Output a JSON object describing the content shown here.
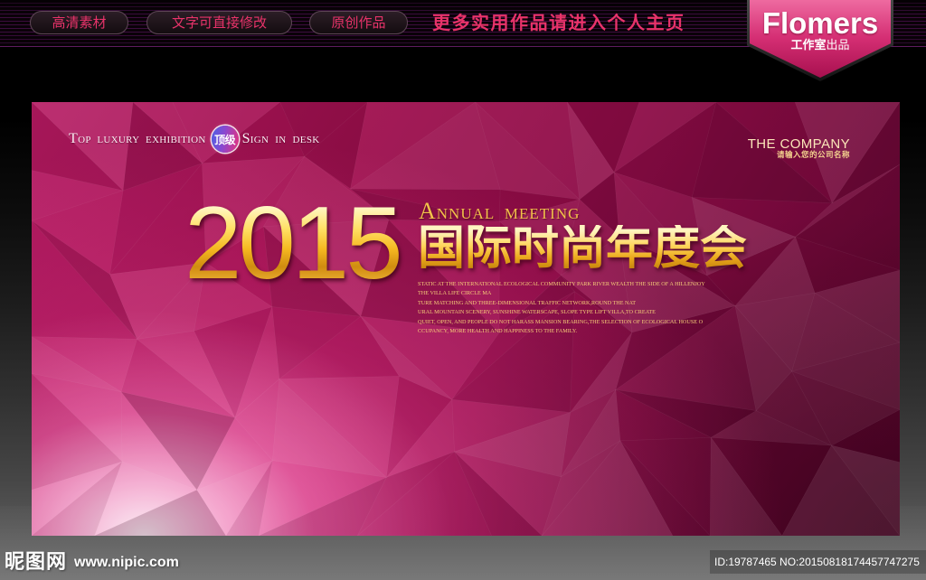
{
  "top_bar": {
    "tags": [
      {
        "label": "高清素材"
      },
      {
        "label": "文字可直接修改"
      },
      {
        "label": "原创作品"
      }
    ],
    "promo": "更多实用作品请进入个人主页"
  },
  "badge": {
    "brand": "Flomers",
    "studio": "工作室",
    "produced": "出品"
  },
  "banner": {
    "tagline": {
      "left": "TOP LUXURY EXHIBITION",
      "seal": "顶级",
      "right": "SIGN IN DESK"
    },
    "company": {
      "name": "THE COMPANY",
      "hint": "请输入您的公司名称"
    },
    "year": "2015",
    "subtitle_en": "ANNUAL MEETING",
    "title_cn": "国际时尚年度会",
    "description_lines": [
      "STATIC AT THE INTERNATIONAL ECOLOGICAL COMMUNITY PARK RIVER WEALTH THE SIDE OF A HILLENJOY",
      "THE VILLA LIFE CIRCLE MA",
      "TURE MATCHING AND THREE-DIMENSIONAL TRAFFIC NETWORK,ROUND THE NAT",
      "URAL MOUNTAIN SCENERY, SUNSHINE WATERSCAPE, SLOPE TYPE LIFT VILLA,TO CREATE",
      "QUIET, OPEN, AND PEOPLE DO NOT HARASS MANSION BEARING,THE SELECTION OF ECOLOGICAL HOUSE O",
      "CCUPANCY, MORE HEALTH AND HAPPINESS TO THE FAMILY."
    ]
  },
  "footer": {
    "site_name": "昵图网",
    "site_url": "www.nipic.com",
    "image_ids": "ID:19787465 NO:20150818174457747275"
  },
  "colors": {
    "accent": "#e8336a",
    "gold": "#f2c14a",
    "banner_magenta": "#a0104f",
    "badge_pink": "#d52f74"
  }
}
